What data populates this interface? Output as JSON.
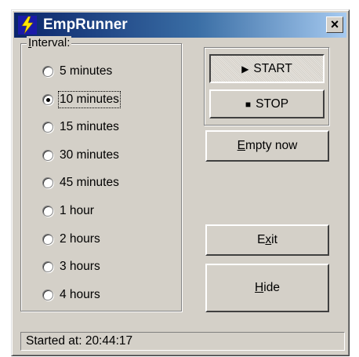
{
  "window": {
    "title": "EmpRunner",
    "close_label": "×"
  },
  "interval": {
    "label_prefix": "I",
    "label_rest": "nterval:",
    "options": [
      {
        "label": "5 minutes",
        "checked": false
      },
      {
        "label": "10 minutes",
        "checked": true
      },
      {
        "label": "15 minutes",
        "checked": false
      },
      {
        "label": "30 minutes",
        "checked": false
      },
      {
        "label": "45 minutes",
        "checked": false
      },
      {
        "label": "1 hour",
        "checked": false
      },
      {
        "label": "2 hours",
        "checked": false
      },
      {
        "label": "3 hours",
        "checked": false
      },
      {
        "label": "4 hours",
        "checked": false
      }
    ]
  },
  "buttons": {
    "start": "START",
    "stop": "STOP",
    "empty_u": "E",
    "empty_rest": "mpty now",
    "exit_pre": "E",
    "exit_u": "x",
    "exit_rest": "it",
    "hide_u": "H",
    "hide_rest": "ide"
  },
  "status": {
    "text": "Started at: 20:44:17"
  },
  "colors": {
    "titlebar_start": "#0a246a",
    "titlebar_end": "#a6caf0",
    "face": "#d4d0c8"
  },
  "icons": {
    "app": "emprunner-app-icon",
    "start": "play-triangle-icon",
    "stop": "stop-square-icon"
  }
}
